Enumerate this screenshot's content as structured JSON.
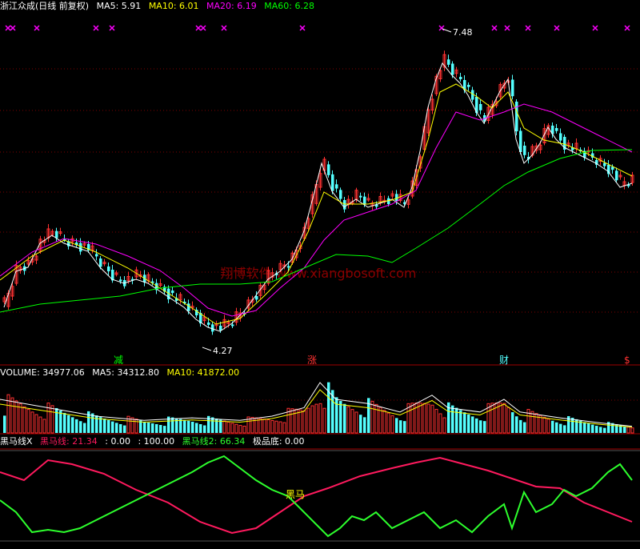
{
  "header": {
    "stock_name": "浙江众成(日线 前复权)",
    "ma5_label": "MA5: 5.91",
    "ma10_label": "MA10: 6.01",
    "ma20_label": "MA20: 6.19",
    "ma60_label": "MA60: 6.28"
  },
  "volume_header": {
    "volume_label": "VOLUME: 34977.06",
    "ma5_label": "MA5: 34312.80",
    "ma10_label": "MA10: 41872.00"
  },
  "indicator_header": {
    "name": "黑马线X",
    "line1_label": "黑马线: 21.34",
    "v2": ": 0.00",
    "v3": ": 100.00",
    "line2_label": "黑马线2: 66.34",
    "bottom_label": "极品底: 0.00"
  },
  "annotations": {
    "high_label": "7.48",
    "low_label": "4.27",
    "signal1": "减",
    "signal2": "涨",
    "signal3": "财",
    "signal4": "$",
    "heima_text": "黑马",
    "watermark": "翔博软件 www.xiangbosoft.com"
  },
  "colors": {
    "up": "#ff3232",
    "down": "#54ffff",
    "ma5": "#ffffff",
    "ma10": "#ffff00",
    "ma20": "#ff00ff",
    "ma60": "#00ff00",
    "line1": "#ff1a5e",
    "line2": "#2dff2d",
    "grid": "#800000",
    "cross": "#ff00ff"
  },
  "chart_data": {
    "type": "candlestick",
    "ylim": [
      4.27,
      7.48
    ],
    "high_price": 7.48,
    "low_price": 4.27,
    "indicator_ylim": [
      0,
      100
    ],
    "ma_period_labels": [
      "MA5",
      "MA10",
      "MA20",
      "MA60"
    ]
  }
}
